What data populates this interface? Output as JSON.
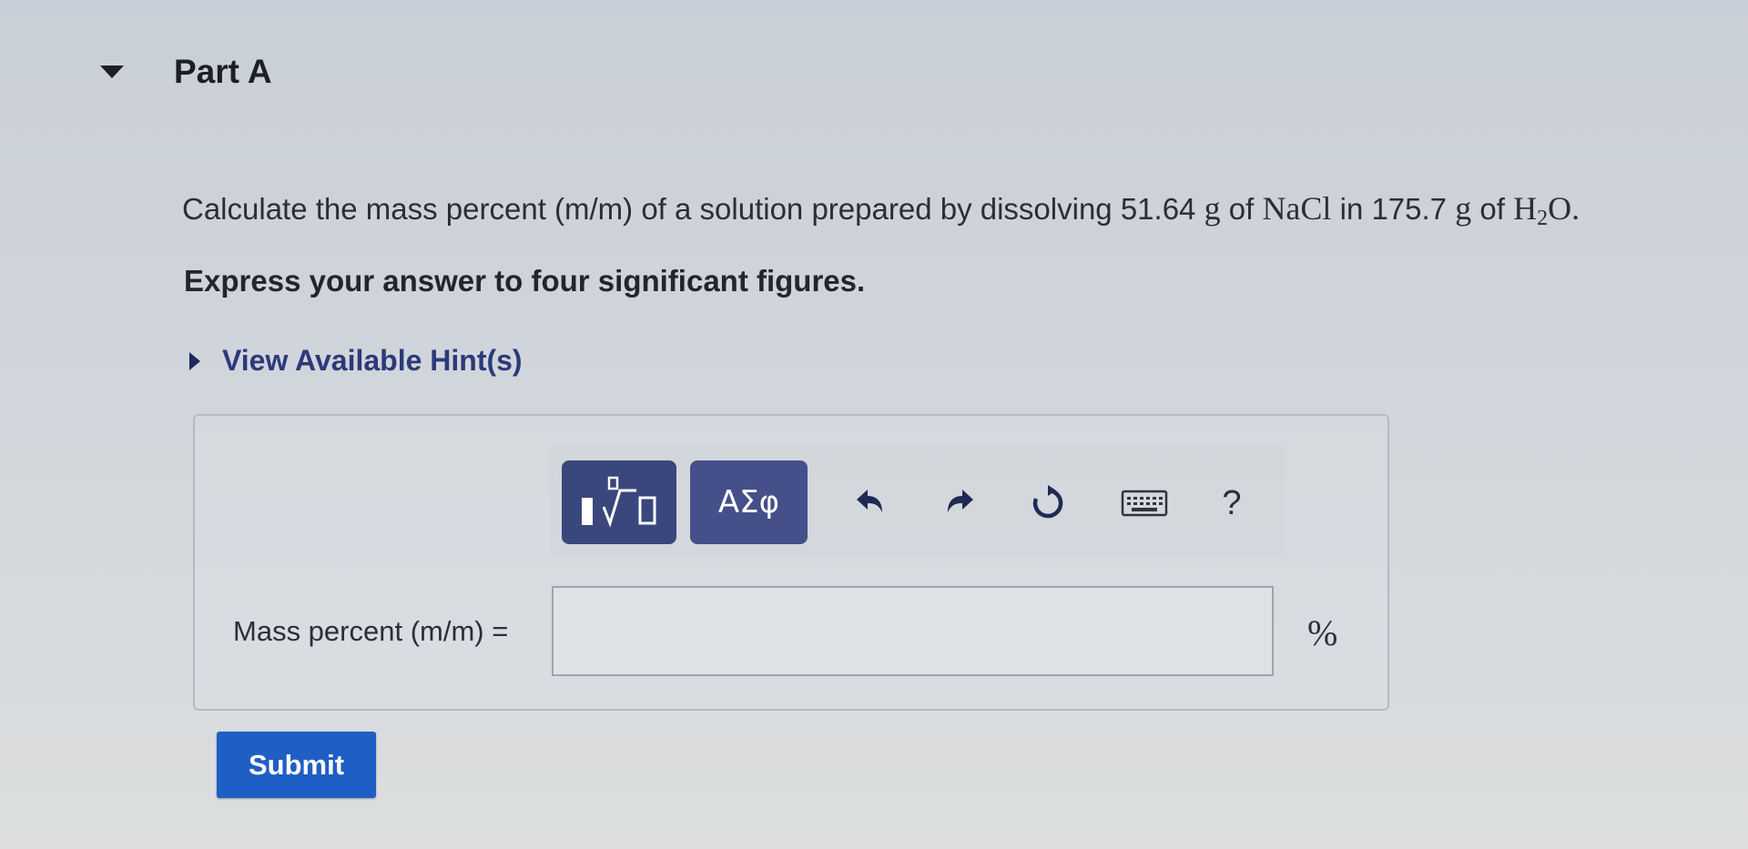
{
  "part": {
    "title": "Part A"
  },
  "question": {
    "prefix": "Calculate the mass percent (m/m) of a solution prepared by dissolving 51.64 ",
    "unit_g1": "g",
    "of1": " of ",
    "solute": "NaCl",
    "in_text": " in 175.7 ",
    "unit_g2": "g",
    "of2": " of ",
    "solvent_h": "H",
    "solvent_sub": "2",
    "solvent_o": "O.",
    "instruction": "Express your answer to four significant figures."
  },
  "hint": {
    "label": "View Available Hint(s)"
  },
  "toolbar": {
    "greek_label": "ΑΣφ",
    "help_label": "?",
    "icons": [
      "templates-icon",
      "undo-icon",
      "redo-icon",
      "reset-icon",
      "keyboard-icon",
      "help-icon"
    ]
  },
  "answer": {
    "label": "Mass percent (m/m) =",
    "value": "",
    "unit": "%"
  },
  "submit": {
    "label": "Submit"
  },
  "colors": {
    "toolbar_button": "#3c4a80",
    "submit_button": "#1f5ec4",
    "hint_link": "#2b3a7a"
  }
}
